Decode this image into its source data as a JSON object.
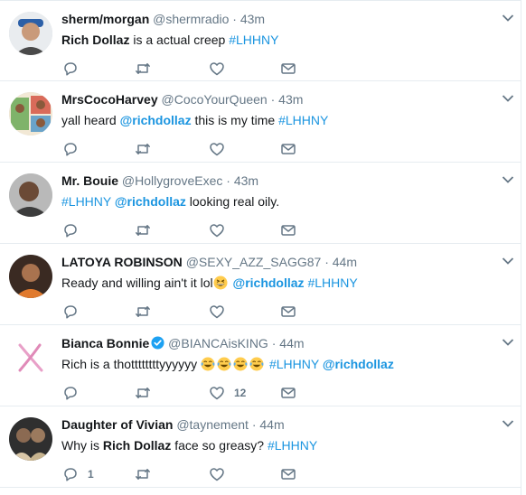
{
  "tweets": [
    {
      "name": "sherm/morgan",
      "handle": "@shermradio",
      "dot": "·",
      "time": "43m",
      "parts": [
        "Rich Dollaz",
        " is a actual creep ",
        "#LHHNY"
      ],
      "reply_count": "",
      "like_count": ""
    },
    {
      "name": "MrsCocoHarvey",
      "handle": "@CocoYourQueen",
      "dot": "·",
      "time": "43m",
      "parts": [
        "yall heard ",
        "@richdollaz",
        " this is my time ",
        "#LHHNY"
      ],
      "reply_count": "",
      "like_count": ""
    },
    {
      "name": "Mr. Bouie",
      "handle": "@HollygroveExec",
      "dot": "·",
      "time": "43m",
      "parts": [
        "#LHHNY",
        " ",
        "@richdollaz",
        " looking real oily."
      ],
      "reply_count": "",
      "like_count": ""
    },
    {
      "name": "LATOYA ROBINSON",
      "handle": "@SEXY_AZZ_SAGG87",
      "dot": "·",
      "time": "44m",
      "parts": [
        "Ready and willing ain't it lol",
        " ",
        "@richdollaz",
        " ",
        "#LHHNY"
      ],
      "emoji": "grinning-squinting-face",
      "reply_count": "",
      "like_count": ""
    },
    {
      "name": "Bianca Bonnie",
      "handle": "@BIANCAisKING",
      "dot": "·",
      "time": "44m",
      "verified": true,
      "parts": [
        "Rich is a thottttttttyyyyyy ",
        " ",
        "#LHHNY",
        " ",
        "@richdollaz"
      ],
      "emoji": "face-with-tears-of-joy",
      "emoji_count": 4,
      "reply_count": "",
      "like_count": "12"
    },
    {
      "name": "Daughter of Vivian",
      "handle": "@taynement",
      "dot": "·",
      "time": "44m",
      "parts": [
        "Why is ",
        "Rich Dollaz",
        " face so greasy? ",
        "#LHHNY"
      ],
      "reply_count": "1",
      "like_count": ""
    }
  ],
  "icons": {
    "reply": "reply-icon",
    "retweet": "retweet-icon",
    "like": "heart-icon",
    "dm": "envelope-icon",
    "more": "chevron-down-icon",
    "verified": "verified-badge-icon"
  },
  "colors": {
    "link": "#1b95e0",
    "meta": "#657786",
    "text": "#14171a",
    "border": "#e6ecf0",
    "verified": "#1da1f2"
  }
}
